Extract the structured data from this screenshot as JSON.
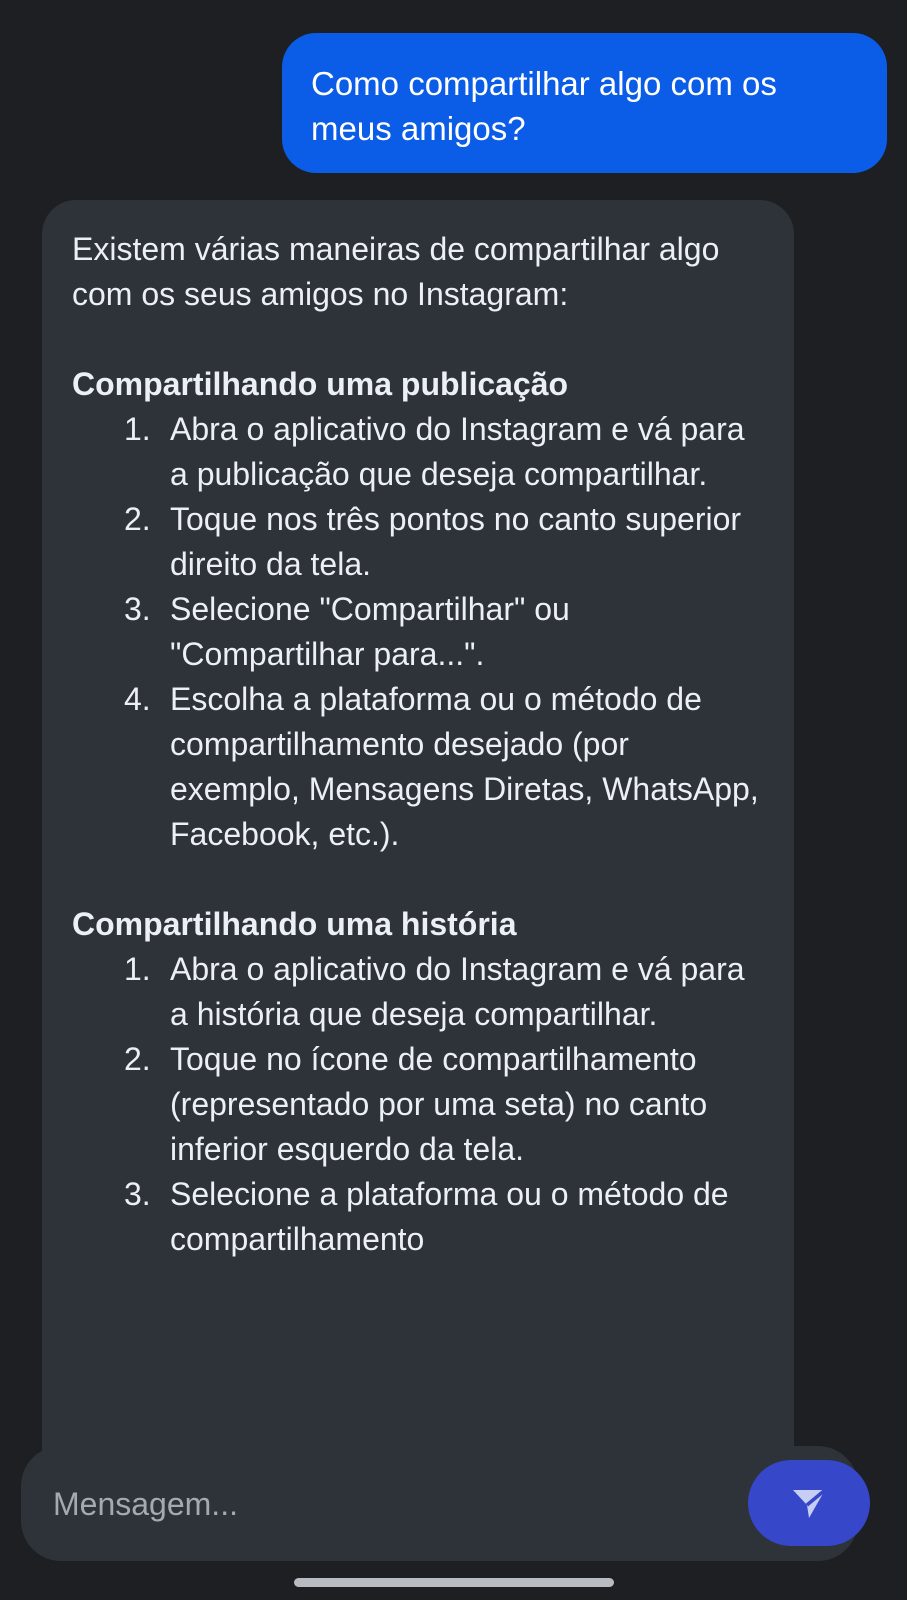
{
  "chat": {
    "user_message": "Como compartilhar algo com os meus amigos?",
    "bot_message": {
      "intro": "Existem várias maneiras de compartilhar algo com os seus amigos no Instagram:",
      "sections": [
        {
          "title": "Compartilhando uma publicação",
          "steps": [
            {
              "num": "1.",
              "text": "Abra o aplicativo do Instagram e vá para a publicação que deseja compartilhar."
            },
            {
              "num": "2.",
              "text": "Toque nos três pontos no canto superior direito da tela."
            },
            {
              "num": "3.",
              "text": "Selecione \"Compartilhar\" ou \"Compartilhar para...\"."
            },
            {
              "num": "4.",
              "text": "Escolha a plataforma ou o método de compartilhamento desejado (por exemplo, Mensagens Diretas, WhatsApp, Facebook, etc.)."
            }
          ]
        },
        {
          "title": "Compartilhando uma história",
          "steps": [
            {
              "num": "1.",
              "text": "Abra o aplicativo do Instagram e vá para a história que deseja compartilhar."
            },
            {
              "num": "2.",
              "text": "Toque no ícone de compartilhamento (representado por uma seta) no canto inferior esquerdo da tela."
            },
            {
              "num": "3.",
              "text": "Selecione a plataforma ou o método de compartilhamento"
            }
          ]
        }
      ]
    }
  },
  "composer": {
    "placeholder": "Mensagem...",
    "value": "",
    "send_icon": "send-icon"
  },
  "colors": {
    "background": "#1d1f23",
    "user_bubble": "#0b5ce6",
    "bot_bubble": "#2e3239",
    "send_button": "#3747c9"
  }
}
